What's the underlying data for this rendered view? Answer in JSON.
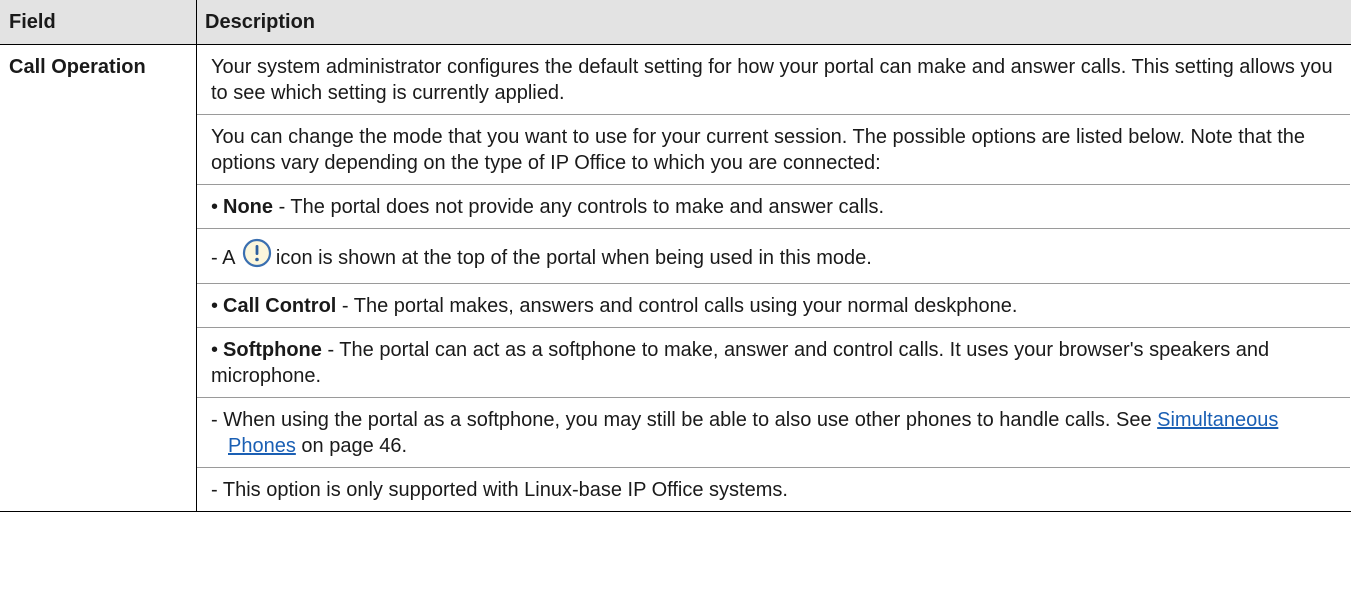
{
  "table": {
    "headers": {
      "field": "Field",
      "description": "Description"
    },
    "row": {
      "field": "Call Operation",
      "p1": "Your system administrator configures the default setting for how your portal can make and answer calls. This setting allows you to see which setting is currently applied.",
      "p2": "You can change the mode that you want to use for your current session. The possible options are listed below. Note that the options vary depending on the type of IP Office to which you are connected:",
      "bullet_none": {
        "mark": "•",
        "term": "None",
        "text": " - The portal does not provide any controls to make and answer calls."
      },
      "sub_none": {
        "dash": "- A",
        "icon": "exclamation-circle-icon",
        "text": "icon is shown at the top of the portal when being used in this mode."
      },
      "bullet_call_control": {
        "mark": "•",
        "term": "Call Control",
        "text": " - The portal makes, answers and control calls using your normal deskphone."
      },
      "bullet_softphone": {
        "mark": "•",
        "term": "Softphone",
        "text": " - The portal can act as a softphone to make, answer and control calls. It uses your browser's speakers and microphone."
      },
      "sub_softphone_1": {
        "text": "- When using the portal as a softphone, you may still be able to also use other phones to handle calls. See ",
        "link": "Simultaneous Phones",
        "after": " on page 46."
      },
      "sub_softphone_2": {
        "text": "- This option is only supported with Linux-base IP Office systems."
      }
    }
  },
  "colors": {
    "header_bg": "#e3e3e3",
    "link": "#1a5fb4",
    "icon_stroke": "#3a6fb0",
    "icon_fill": "#fbf6dc"
  }
}
